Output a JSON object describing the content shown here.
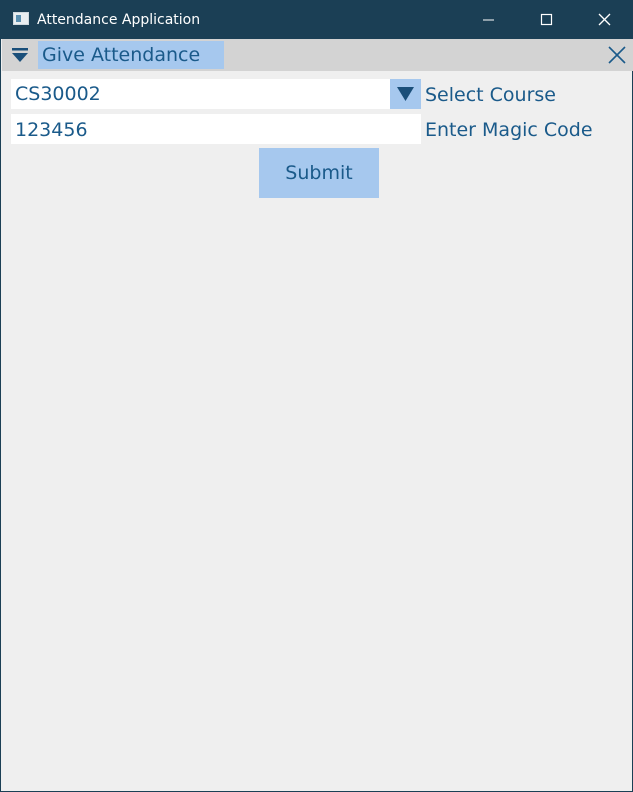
{
  "window": {
    "title": "Attendance Application"
  },
  "tabs": [
    {
      "label": "Give Attendance",
      "active": true
    }
  ],
  "form": {
    "course_select": {
      "value": "CS30002",
      "label": "Select Course"
    },
    "magic_code": {
      "value": "123456",
      "label": "Enter Magic Code"
    },
    "submit_label": "Submit"
  },
  "colors": {
    "titlebar": "#1b3f55",
    "accent": "#a6c8ee",
    "text": "#1a5a8a",
    "background": "#efefef",
    "tabstrip": "#d3d3d3"
  },
  "icons": {
    "app": "app-window-icon",
    "minimize": "minimize-icon",
    "maximize": "maximize-icon",
    "close": "close-icon",
    "tab_menu": "tab-menu-icon",
    "tab_close": "tab-close-icon",
    "dropdown": "chevron-down-icon"
  }
}
